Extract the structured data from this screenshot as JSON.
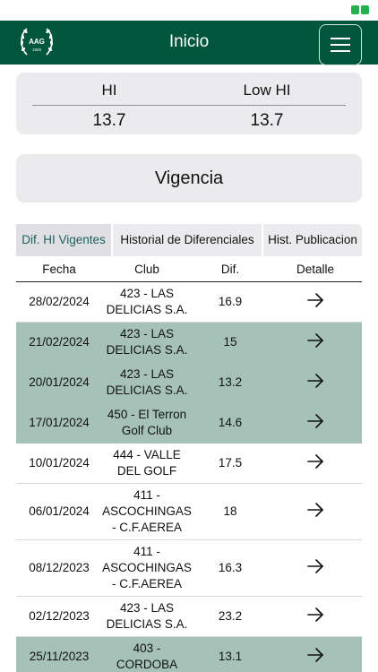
{
  "header": {
    "title": "Inicio",
    "logo_text": "AAG",
    "logo_year": "1926"
  },
  "hi_card": {
    "hi_label": "HI",
    "hi_value": "13.7",
    "low_hi_label": "Low HI",
    "low_hi_value": "13.7"
  },
  "vigencia": {
    "label": "Vigencia"
  },
  "tabs": [
    {
      "label": "Dif. HI Vigentes",
      "active": true
    },
    {
      "label": "Historial de Diferenciales",
      "active": false
    },
    {
      "label": "Hist. Publicacion",
      "active": false
    }
  ],
  "table": {
    "columns": [
      "Fecha",
      "Club",
      "Dif.",
      "Detalle"
    ],
    "rows": [
      {
        "date": "28/02/2024",
        "club": "423 - LAS DELICIAS S.A.",
        "dif": "16.9",
        "highlight": false
      },
      {
        "date": "21/02/2024",
        "club": "423 - LAS DELICIAS S.A.",
        "dif": "15",
        "highlight": true
      },
      {
        "date": "20/01/2024",
        "club": "423 - LAS DELICIAS S.A.",
        "dif": "13.2",
        "highlight": true
      },
      {
        "date": "17/01/2024",
        "club": "450 - El Terron Golf Club",
        "dif": "14.6",
        "highlight": true
      },
      {
        "date": "10/01/2024",
        "club": "444 - VALLE DEL GOLF",
        "dif": "17.5",
        "highlight": false
      },
      {
        "date": "06/01/2024",
        "club": "411 - ASCOCHINGAS - C.F.AEREA",
        "dif": "18",
        "highlight": false
      },
      {
        "date": "08/12/2023",
        "club": "411 - ASCOCHINGAS - C.F.AEREA",
        "dif": "16.3",
        "highlight": false
      },
      {
        "date": "02/12/2023",
        "club": "423 - LAS DELICIAS S.A.",
        "dif": "23.2",
        "highlight": false
      },
      {
        "date": "25/11/2023",
        "club": "403 - CORDOBA",
        "dif": "13.1",
        "highlight": true
      }
    ]
  },
  "colors": {
    "brand_green": "#00563b",
    "row_highlight": "#a6c2b8",
    "card_bg": "#ebebed",
    "active_tab_text": "#1f5f5a"
  },
  "icons": {
    "menu": "hamburger-icon",
    "detail": "arrow-right-icon",
    "status": "battery-icon"
  }
}
